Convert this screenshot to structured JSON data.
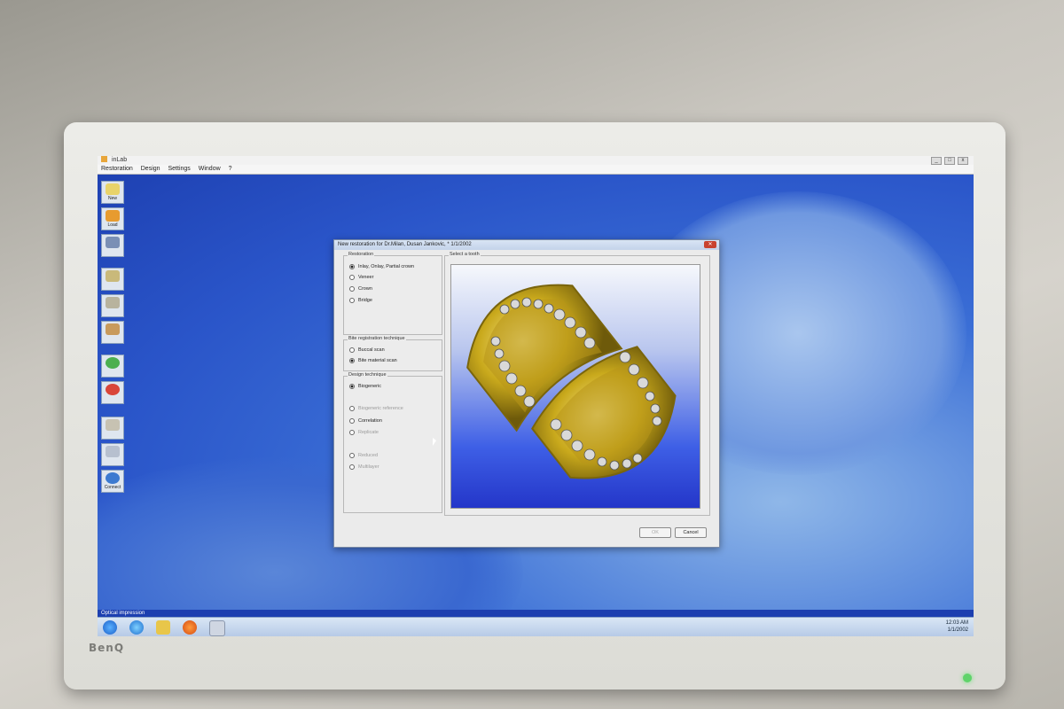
{
  "window": {
    "title": "inLab"
  },
  "menu": [
    "Restoration",
    "Design",
    "Settings",
    "Window",
    "?"
  ],
  "toolbar": {
    "new_label": "New",
    "load_label": "Load",
    "connect_label": "Connect"
  },
  "dialog": {
    "title": "New restoration for Dr.Milan, Dusan Jankovic, * 1/1/2002",
    "restoration": {
      "label": "Restoration",
      "options": [
        "Inlay, Onlay, Partial crown",
        "Veneer",
        "Crown",
        "Bridge"
      ],
      "selected": 0
    },
    "bite": {
      "label": "Bite registration technique",
      "options": [
        "Buccal scan",
        "Bite material scan"
      ],
      "selected": 1
    },
    "design": {
      "label": "Design technique",
      "options": [
        "Biogeneric",
        "Biogeneric reference",
        "Correlation",
        "Replicate",
        "Reduced",
        "Multilayer"
      ],
      "selected": 0
    },
    "select_tooth_label": "Select a tooth",
    "ok_label": "OK",
    "cancel_label": "Cancel"
  },
  "status": {
    "text": "Optical impression"
  },
  "tray": {
    "time": "12:03 AM",
    "date": "1/1/2002"
  },
  "brand": "BenQ",
  "colors": {
    "desktop": "#2a55c9",
    "gold": "#d9bf2a",
    "dialog": "#ebebeb"
  }
}
